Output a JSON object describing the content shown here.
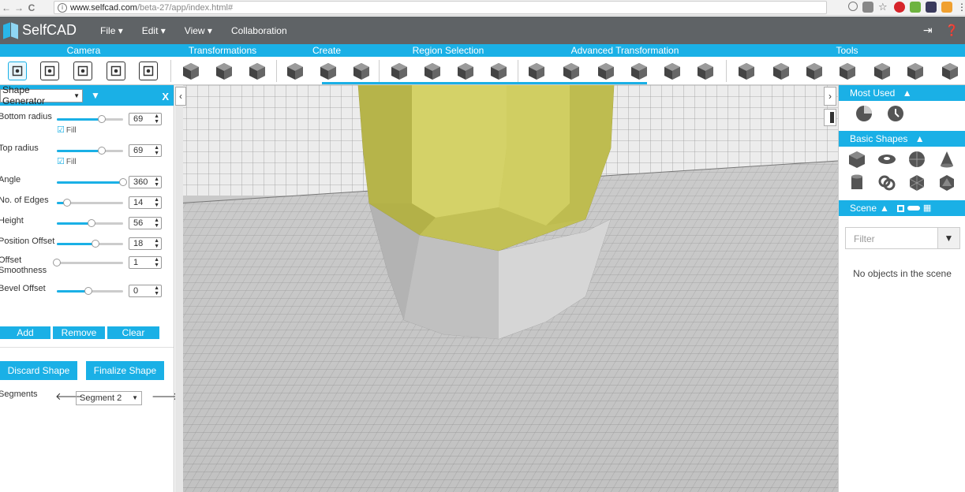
{
  "browser": {
    "back": "←",
    "forward": "→",
    "reload": "C",
    "url_host": "www.selfcad.com",
    "url_path": "/beta-27/app/index.html#"
  },
  "app": {
    "logo": "SelfCAD",
    "menu": [
      "File ▾",
      "Edit ▾",
      "View ▾",
      "Collaboration"
    ]
  },
  "toolbar": {
    "categories": [
      "Camera",
      "Transformations",
      "Create",
      "Region Selection",
      "Advanced Transformation",
      "Tools"
    ]
  },
  "left_panel": {
    "generator": "Shape Generator",
    "close": "X",
    "params": [
      {
        "label": "Bottom radius",
        "value": "69",
        "fill": 0.68
      },
      {
        "label": "Top radius",
        "value": "69",
        "fill": 0.68
      },
      {
        "label": "Angle",
        "value": "360",
        "fill": 1.0
      },
      {
        "label": "No. of Edges",
        "value": "14",
        "fill": 0.15
      },
      {
        "label": "Height",
        "value": "56",
        "fill": 0.52
      },
      {
        "label": "Position Offset",
        "value": "18",
        "fill": 0.58
      },
      {
        "label": "Offset Smoothness",
        "value": "1",
        "fill": 0.0
      },
      {
        "label": "Bevel Offset",
        "value": "0",
        "fill": 0.48
      }
    ],
    "fill_label": "Fill",
    "segments_label": "Segments",
    "segment_selected": "Segment 2",
    "buttons": {
      "add": "Add",
      "remove": "Remove",
      "clear": "Clear"
    },
    "discard": "Discard Shape",
    "finalize": "Finalize Shape"
  },
  "right_panel": {
    "most_used": "Most Used",
    "basic_shapes": "Basic Shapes",
    "scene": "Scene",
    "filter_placeholder": "Filter",
    "empty_scene": "No objects in the scene"
  },
  "colors": {
    "accent": "#1ab0e6",
    "header": "#5f6366",
    "shape_top": "#c8c65a",
    "shape_bottom": "#c4c4c4"
  }
}
